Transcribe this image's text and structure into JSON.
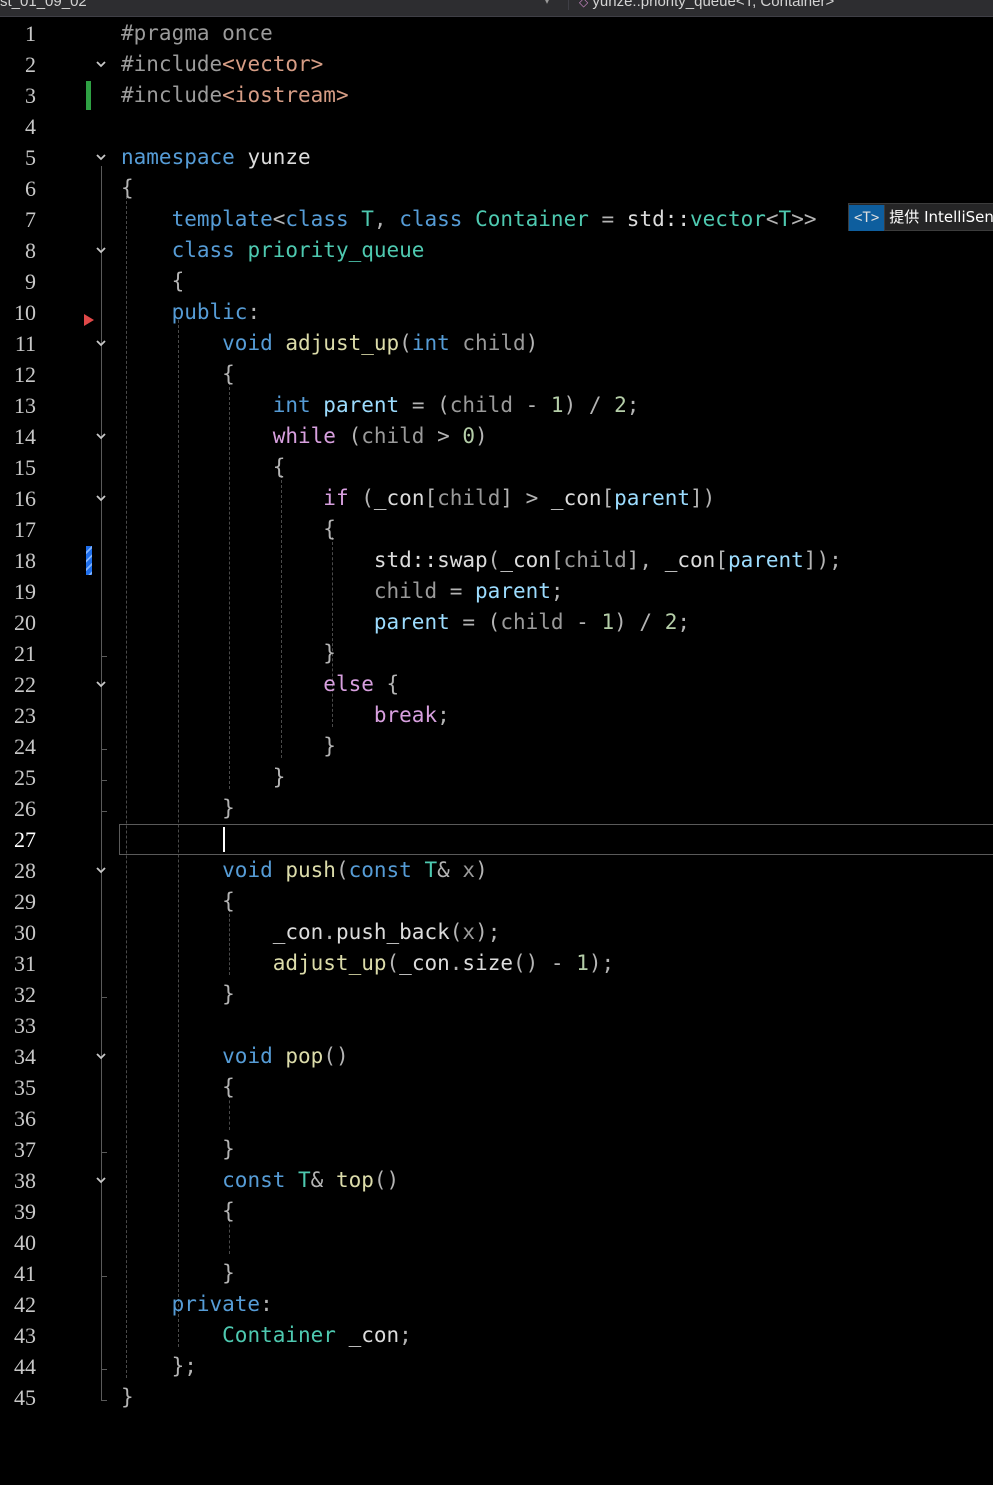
{
  "toolbar": {
    "file_dropdown": "st_01_09_02",
    "scope_dropdown": "yunze::priority_queue<T, Container>"
  },
  "inline_hint": {
    "badge": "<T>",
    "text": "提供 IntelliSen"
  },
  "editor": {
    "current_line": 27,
    "colors": {
      "background": "#000000",
      "keyword": "#569cd6",
      "type": "#4ec9b0",
      "function": "#dcdcaa",
      "member": "#9cdcfe",
      "number": "#b5cea8"
    },
    "lines": [
      {
        "n": 1,
        "tokens": [
          [
            "k-pre",
            "#pragma once"
          ]
        ]
      },
      {
        "n": 2,
        "tokens": [
          [
            "k-pre",
            "#include"
          ],
          [
            "k-str",
            "<vector>"
          ]
        ]
      },
      {
        "n": 3,
        "tokens": [
          [
            "k-pre",
            "#include"
          ],
          [
            "k-str",
            "<iostream>"
          ]
        ]
      },
      {
        "n": 4,
        "tokens": []
      },
      {
        "n": 5,
        "tokens": [
          [
            "k-blue",
            "namespace"
          ],
          [
            "k-plain",
            " yunze"
          ]
        ]
      },
      {
        "n": 6,
        "tokens": [
          [
            "k-pun",
            "{"
          ]
        ]
      },
      {
        "n": 7,
        "tokens": [
          [
            "k-plain",
            "    "
          ],
          [
            "k-blue",
            "template"
          ],
          [
            "k-pun",
            "<"
          ],
          [
            "k-blue",
            "class"
          ],
          [
            "k-type",
            " T"
          ],
          [
            "k-pun",
            ", "
          ],
          [
            "k-blue",
            "class"
          ],
          [
            "k-type",
            " Container"
          ],
          [
            "k-pun",
            " = "
          ],
          [
            "k-plain",
            "std::"
          ],
          [
            "k-type",
            "vector"
          ],
          [
            "k-pun",
            "<"
          ],
          [
            "k-type",
            "T"
          ],
          [
            "k-pun",
            ">>"
          ]
        ]
      },
      {
        "n": 8,
        "tokens": [
          [
            "k-plain",
            "    "
          ],
          [
            "k-blue",
            "class"
          ],
          [
            "k-type",
            " priority_queue"
          ]
        ]
      },
      {
        "n": 9,
        "tokens": [
          [
            "k-plain",
            "    "
          ],
          [
            "k-pun",
            "{"
          ]
        ]
      },
      {
        "n": 10,
        "tokens": [
          [
            "k-plain",
            "    "
          ],
          [
            "k-blue",
            "public"
          ],
          [
            "k-pun",
            ":"
          ]
        ]
      },
      {
        "n": 11,
        "tokens": [
          [
            "k-plain",
            "        "
          ],
          [
            "k-blue",
            "void"
          ],
          [
            "k-fn",
            " adjust_up"
          ],
          [
            "k-pun",
            "("
          ],
          [
            "k-blue",
            "int"
          ],
          [
            "k-param",
            " child"
          ],
          [
            "k-pun",
            ")"
          ]
        ]
      },
      {
        "n": 12,
        "tokens": [
          [
            "k-plain",
            "        "
          ],
          [
            "k-pun",
            "{"
          ]
        ]
      },
      {
        "n": 13,
        "tokens": [
          [
            "k-plain",
            "            "
          ],
          [
            "k-blue",
            "int"
          ],
          [
            "k-var",
            " parent"
          ],
          [
            "k-pun",
            " = ("
          ],
          [
            "k-param",
            "child"
          ],
          [
            "k-pun",
            " - "
          ],
          [
            "k-num",
            "1"
          ],
          [
            "k-pun",
            ") / "
          ],
          [
            "k-num",
            "2"
          ],
          [
            "k-pun",
            ";"
          ]
        ]
      },
      {
        "n": 14,
        "tokens": [
          [
            "k-plain",
            "            "
          ],
          [
            "k-purple",
            "while"
          ],
          [
            "k-pun",
            " ("
          ],
          [
            "k-param",
            "child"
          ],
          [
            "k-pun",
            " > "
          ],
          [
            "k-num",
            "0"
          ],
          [
            "k-pun",
            ")"
          ]
        ]
      },
      {
        "n": 15,
        "tokens": [
          [
            "k-plain",
            "            "
          ],
          [
            "k-pun",
            "{"
          ]
        ]
      },
      {
        "n": 16,
        "tokens": [
          [
            "k-plain",
            "                "
          ],
          [
            "k-purple",
            "if"
          ],
          [
            "k-pun",
            " ("
          ],
          [
            "k-plain",
            "_con"
          ],
          [
            "k-pun",
            "["
          ],
          [
            "k-param",
            "child"
          ],
          [
            "k-pun",
            "] > "
          ],
          [
            "k-plain",
            "_con"
          ],
          [
            "k-pun",
            "["
          ],
          [
            "k-var",
            "parent"
          ],
          [
            "k-pun",
            "])"
          ]
        ]
      },
      {
        "n": 17,
        "tokens": [
          [
            "k-plain",
            "                "
          ],
          [
            "k-pun",
            "{"
          ]
        ]
      },
      {
        "n": 18,
        "tokens": [
          [
            "k-plain",
            "                    std::"
          ],
          [
            "k-plain",
            "swap"
          ],
          [
            "k-pun",
            "("
          ],
          [
            "k-plain",
            "_con"
          ],
          [
            "k-pun",
            "["
          ],
          [
            "k-param",
            "child"
          ],
          [
            "k-pun",
            "], "
          ],
          [
            "k-plain",
            "_con"
          ],
          [
            "k-pun",
            "["
          ],
          [
            "k-var",
            "parent"
          ],
          [
            "k-pun",
            "]);"
          ]
        ]
      },
      {
        "n": 19,
        "tokens": [
          [
            "k-plain",
            "                    "
          ],
          [
            "k-param",
            "child"
          ],
          [
            "k-pun",
            " = "
          ],
          [
            "k-var",
            "parent"
          ],
          [
            "k-pun",
            ";"
          ]
        ]
      },
      {
        "n": 20,
        "tokens": [
          [
            "k-plain",
            "                    "
          ],
          [
            "k-var",
            "parent"
          ],
          [
            "k-pun",
            " = ("
          ],
          [
            "k-param",
            "child"
          ],
          [
            "k-pun",
            " - "
          ],
          [
            "k-num",
            "1"
          ],
          [
            "k-pun",
            ") / "
          ],
          [
            "k-num",
            "2"
          ],
          [
            "k-pun",
            ";"
          ]
        ]
      },
      {
        "n": 21,
        "tokens": [
          [
            "k-plain",
            "                "
          ],
          [
            "k-pun",
            "}"
          ]
        ]
      },
      {
        "n": 22,
        "tokens": [
          [
            "k-plain",
            "                "
          ],
          [
            "k-purple",
            "else"
          ],
          [
            "k-pun",
            " {"
          ]
        ]
      },
      {
        "n": 23,
        "tokens": [
          [
            "k-plain",
            "                    "
          ],
          [
            "k-purple",
            "break"
          ],
          [
            "k-pun",
            ";"
          ]
        ]
      },
      {
        "n": 24,
        "tokens": [
          [
            "k-plain",
            "                "
          ],
          [
            "k-pun",
            "}"
          ]
        ]
      },
      {
        "n": 25,
        "tokens": [
          [
            "k-plain",
            "            "
          ],
          [
            "k-pun",
            "}"
          ]
        ]
      },
      {
        "n": 26,
        "tokens": [
          [
            "k-plain",
            "        "
          ],
          [
            "k-pun",
            "}"
          ]
        ]
      },
      {
        "n": 27,
        "tokens": []
      },
      {
        "n": 28,
        "tokens": [
          [
            "k-plain",
            "        "
          ],
          [
            "k-blue",
            "void"
          ],
          [
            "k-fn",
            " push"
          ],
          [
            "k-pun",
            "("
          ],
          [
            "k-blue",
            "const"
          ],
          [
            "k-type",
            " T"
          ],
          [
            "k-pun",
            "& "
          ],
          [
            "k-param",
            "x"
          ],
          [
            "k-pun",
            ")"
          ]
        ]
      },
      {
        "n": 29,
        "tokens": [
          [
            "k-plain",
            "        "
          ],
          [
            "k-pun",
            "{"
          ]
        ]
      },
      {
        "n": 30,
        "tokens": [
          [
            "k-plain",
            "            _con"
          ],
          [
            "k-pun",
            "."
          ],
          [
            "k-plain",
            "push_back"
          ],
          [
            "k-pun",
            "("
          ],
          [
            "k-param",
            "x"
          ],
          [
            "k-pun",
            ");"
          ]
        ]
      },
      {
        "n": 31,
        "tokens": [
          [
            "k-plain",
            "            "
          ],
          [
            "k-fn",
            "adjust_up"
          ],
          [
            "k-pun",
            "("
          ],
          [
            "k-plain",
            "_con"
          ],
          [
            "k-pun",
            "."
          ],
          [
            "k-plain",
            "size"
          ],
          [
            "k-pun",
            "() - "
          ],
          [
            "k-num",
            "1"
          ],
          [
            "k-pun",
            ");"
          ]
        ]
      },
      {
        "n": 32,
        "tokens": [
          [
            "k-plain",
            "        "
          ],
          [
            "k-pun",
            "}"
          ]
        ]
      },
      {
        "n": 33,
        "tokens": []
      },
      {
        "n": 34,
        "tokens": [
          [
            "k-plain",
            "        "
          ],
          [
            "k-blue",
            "void"
          ],
          [
            "k-fn",
            " pop"
          ],
          [
            "k-pun",
            "()"
          ]
        ]
      },
      {
        "n": 35,
        "tokens": [
          [
            "k-plain",
            "        "
          ],
          [
            "k-pun",
            "{"
          ]
        ]
      },
      {
        "n": 36,
        "tokens": []
      },
      {
        "n": 37,
        "tokens": [
          [
            "k-plain",
            "        "
          ],
          [
            "k-pun",
            "}"
          ]
        ]
      },
      {
        "n": 38,
        "tokens": [
          [
            "k-plain",
            "        "
          ],
          [
            "k-blue",
            "const"
          ],
          [
            "k-type",
            " T"
          ],
          [
            "k-pun",
            "& "
          ],
          [
            "k-fn",
            "top"
          ],
          [
            "k-pun",
            "()"
          ]
        ]
      },
      {
        "n": 39,
        "tokens": [
          [
            "k-plain",
            "        "
          ],
          [
            "k-pun",
            "{"
          ]
        ]
      },
      {
        "n": 40,
        "tokens": []
      },
      {
        "n": 41,
        "tokens": [
          [
            "k-plain",
            "        "
          ],
          [
            "k-pun",
            "}"
          ]
        ]
      },
      {
        "n": 42,
        "tokens": [
          [
            "k-plain",
            "    "
          ],
          [
            "k-blue",
            "private"
          ],
          [
            "k-pun",
            ":"
          ]
        ]
      },
      {
        "n": 43,
        "tokens": [
          [
            "k-plain",
            "        "
          ],
          [
            "k-type",
            "Container"
          ],
          [
            "k-plain",
            " _con"
          ],
          [
            "k-pun",
            ";"
          ]
        ]
      },
      {
        "n": 44,
        "tokens": [
          [
            "k-plain",
            "    "
          ],
          [
            "k-pun",
            "};"
          ]
        ]
      },
      {
        "n": 45,
        "tokens": [
          [
            "k-pun",
            "}"
          ]
        ]
      }
    ],
    "fold_lines": [
      2,
      5,
      8,
      11,
      14,
      16,
      22,
      28,
      34,
      38
    ],
    "change_marks": {
      "green": [
        3
      ],
      "blue": [
        18
      ]
    },
    "breakpoint_arrow_line": 11
  }
}
